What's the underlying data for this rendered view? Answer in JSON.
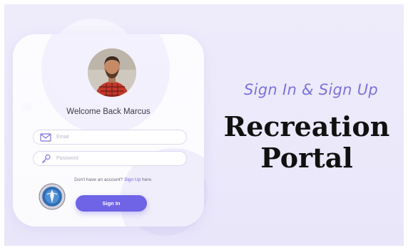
{
  "card": {
    "welcome": "Welcome Back Marcus",
    "email_placeholder": "Email",
    "password_placeholder": "Password",
    "no_account_text": "Don't have an account?",
    "signup_link": "Sign Up",
    "here_text": "here.",
    "signin_label": "Sign In"
  },
  "hero": {
    "tagline": "Sign In & Sign Up",
    "title_line1": "Recreation",
    "title_line2": "Portal"
  },
  "icons": {
    "email": "envelope-icon",
    "password": "key-icon",
    "seal": "emblem-seal"
  },
  "colors": {
    "accent": "#6f63e6",
    "tagline": "#7d72dd",
    "background": "#eeecfb"
  }
}
